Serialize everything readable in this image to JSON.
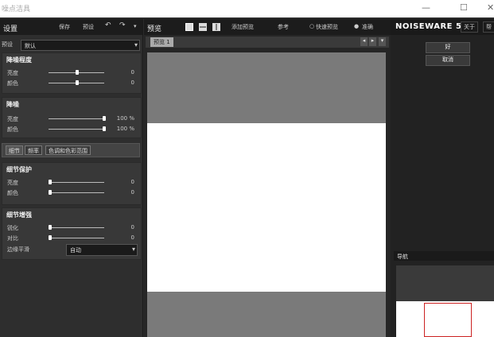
{
  "window": {
    "title": "噪点洁具",
    "minimize_glyph": "—",
    "maximize_glyph": "☐",
    "close_glyph": "✕"
  },
  "left": {
    "header": "设置",
    "save_label": "保存",
    "preset_label": "预设",
    "preset_row_label": "预设",
    "preset_value": "默认",
    "noise_level": {
      "title": "降噪程度",
      "rows": [
        {
          "label": "亮度",
          "value": "0",
          "level": 0.5
        },
        {
          "label": "颜色",
          "value": "0",
          "level": 0.5
        }
      ]
    },
    "noise_reduction": {
      "title": "降噪",
      "rows": [
        {
          "label": "亮度",
          "value": "100 %",
          "level": 1.0
        },
        {
          "label": "颜色",
          "value": "100 %",
          "level": 1.0
        }
      ]
    },
    "tabs": [
      "细节",
      "频率",
      "色调和色彩范围"
    ],
    "detail_protect": {
      "title": "细节保护",
      "rows": [
        {
          "label": "亮度",
          "value": "0",
          "level": 0.0
        },
        {
          "label": "颜色",
          "value": "0",
          "level": 0.0
        }
      ]
    },
    "detail_enhance": {
      "title": "细节增强",
      "rows": [
        {
          "label": "锐化",
          "value": "0",
          "level": 0.0
        },
        {
          "label": "对比",
          "value": "0",
          "level": 0.0
        }
      ],
      "edge_label": "边缘平滑",
      "edge_value": "自动"
    }
  },
  "center": {
    "header": "预览",
    "add_preview_label": "添加预览",
    "reference_label": "参考",
    "fast_preview_label": "快速预览",
    "accurate_label": "准确",
    "tab_label": "预览 1"
  },
  "right": {
    "brand": "NOISEWARE 5",
    "about_label": "关于",
    "help_label": "帮",
    "ok_label": "好",
    "cancel_label": "取消",
    "navigator_label": "导航"
  },
  "colors": {
    "accent_red": "#cc2222"
  }
}
